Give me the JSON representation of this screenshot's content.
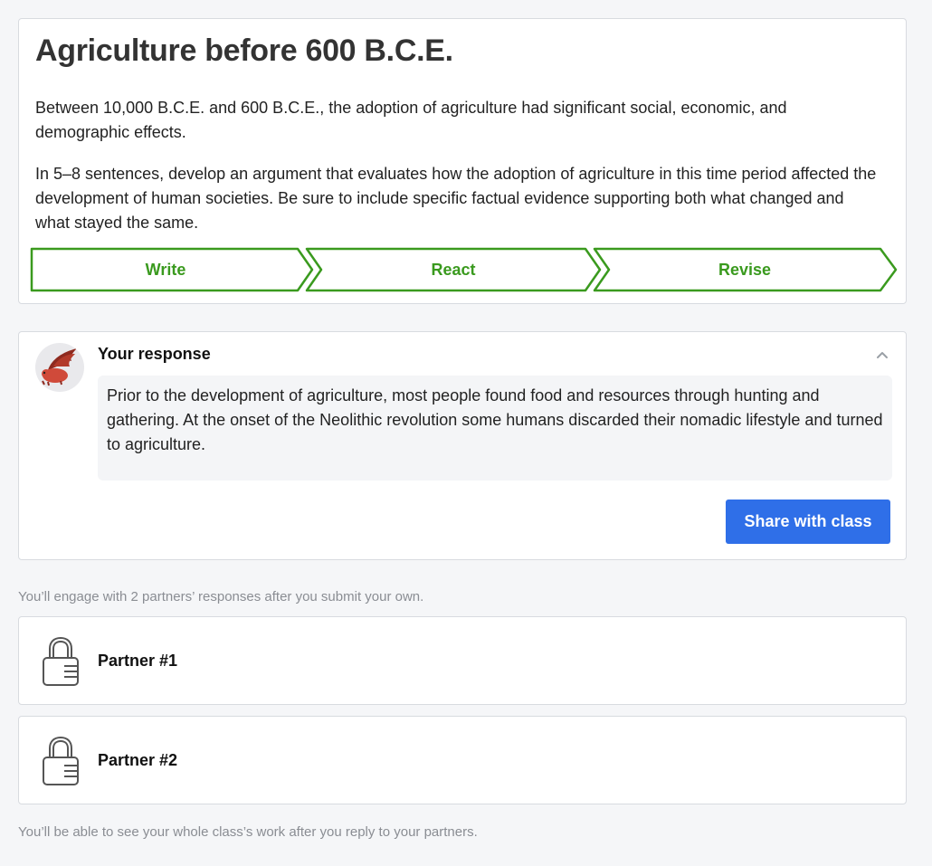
{
  "prompt": {
    "title": "Agriculture before 600 B.C.E.",
    "paragraph_1": "Between 10,000 B.C.E. and 600 B.C.E., the adoption of agriculture had significant social, economic, and demographic effects.",
    "paragraph_2": "In 5–8 sentences, develop an argument that evaluates how the adoption of agriculture in this time period affected the development of human societies. Be sure to include specific factual evidence supporting both what changed and what stayed the same."
  },
  "steps": [
    {
      "label": "Write"
    },
    {
      "label": "React"
    },
    {
      "label": "Revise"
    }
  ],
  "response": {
    "heading": "Your response",
    "text": "Prior to the development of agriculture, most people found food and resources through hunting and gathering. At the onset of the Neolithic revolution some humans discarded their nomadic lifestyle and turned to agriculture.",
    "share_label": "Share with class",
    "avatar_icon": "dragon-icon",
    "collapse_icon": "chevron-up-icon"
  },
  "notes": {
    "engage": "You’ll engage with 2 partners’ responses after you submit your own.",
    "whole_class": "You’ll be able to see your whole class’s work after you reply to your partners."
  },
  "partners": [
    {
      "label": "Partner #1",
      "icon": "lock-icon"
    },
    {
      "label": "Partner #2",
      "icon": "lock-icon"
    }
  ],
  "colors": {
    "step_green": "#3a9a1e",
    "primary_blue": "#2f6fe8",
    "page_background": "#f5f6f8"
  }
}
